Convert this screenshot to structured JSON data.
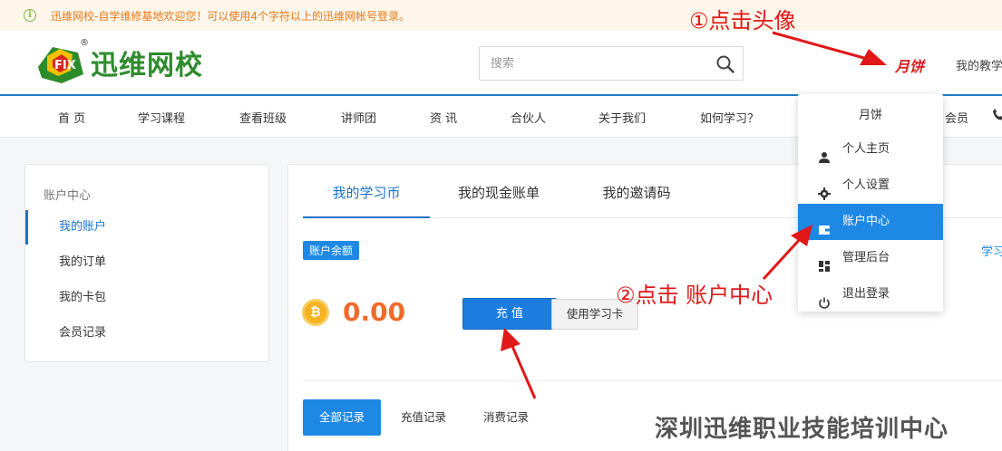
{
  "notice": {
    "text": "迅维网校-自学维修基地欢迎您！可以使用4个字符以上的迅维网帐号登录。",
    "icon": "info-icon"
  },
  "header": {
    "logo_text": "迅维网校",
    "logo_reg": "®",
    "search_placeholder": "搜索",
    "user_name": "月饼",
    "teach_link": "我的教学"
  },
  "nav": {
    "items": [
      "首 页",
      "学习课程",
      "查看班级",
      "讲师团",
      "资 讯",
      "合伙人",
      "关于我们",
      "如何学习？",
      "会员"
    ]
  },
  "sidebar": {
    "title": "账户中心",
    "items": [
      "我的账户",
      "我的订单",
      "我的卡包",
      "会员记录"
    ]
  },
  "main": {
    "tabs": [
      "我的学习币",
      "我的现金账单",
      "我的邀请码"
    ],
    "badge": "账户余额",
    "right_link": "学习",
    "balance": "0.00",
    "recharge_label": "充 值",
    "card_label": "使用学习卡",
    "record_tabs": [
      "全部记录",
      "充值记录",
      "消费记录"
    ]
  },
  "dropdown": {
    "name": "月饼",
    "items": [
      "个人主页",
      "个人设置",
      "账户中心",
      "管理后台",
      "退出登录"
    ]
  },
  "annotations": {
    "step1": "①点击头像",
    "step2": "②点击 账户中心"
  },
  "watermark": "深圳迅维职业技能培训中心",
  "colors": {
    "accent": "#1e88e5",
    "annotation": "#e01818",
    "balance": "#f06a2a",
    "notice_text": "#e8791a"
  }
}
